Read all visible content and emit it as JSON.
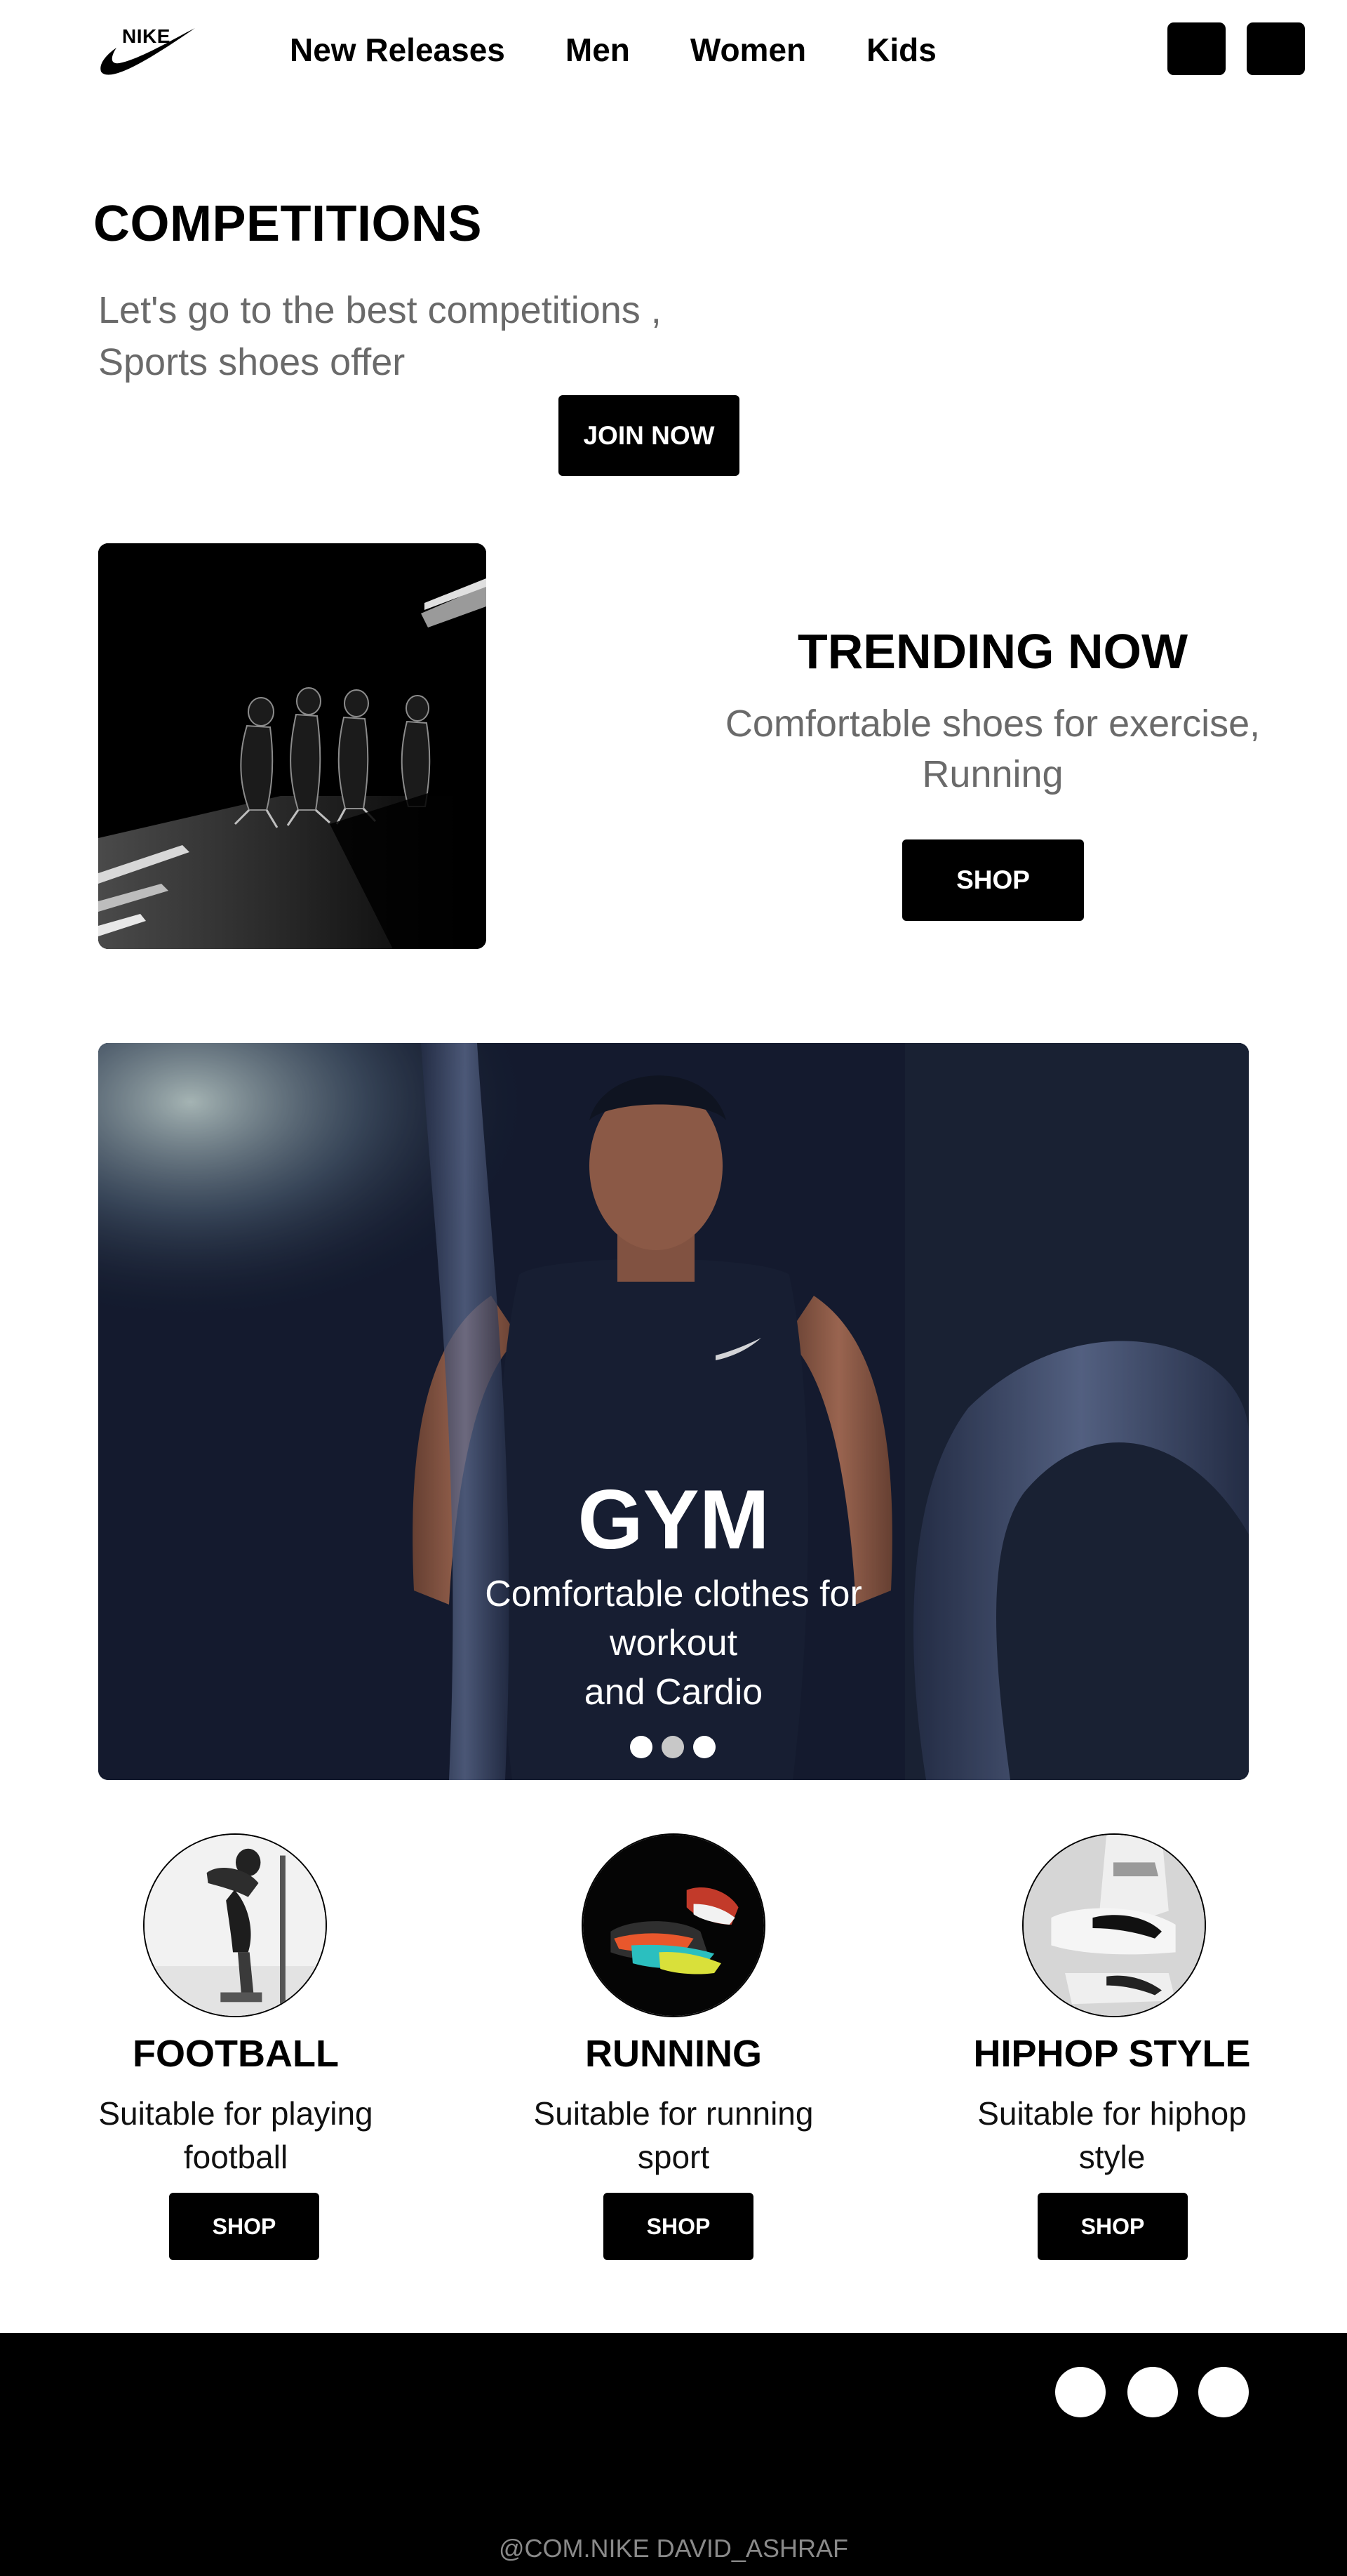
{
  "nav": {
    "logo_text": "NIKE",
    "links": [
      "New Releases",
      "Men",
      "Women",
      "Kids"
    ],
    "icons": [
      "cart-icon",
      "user-icon"
    ]
  },
  "competitions": {
    "title": "COMPETITIONS",
    "subtitle_line1": "Let's go to the best competitions ,",
    "subtitle_line2": "Sports shoes offer",
    "button": "JOIN NOW"
  },
  "trending": {
    "title": "TRENDING NOW",
    "subtitle_line1": "Comfortable shoes for exercise,",
    "subtitle_line2": "Running",
    "button": "SHOP"
  },
  "hero": {
    "title": "GYM",
    "subtitle_line1": "Comfortable clothes for workout",
    "subtitle_line2": "and Cardio",
    "slide_count": 3
  },
  "categories": [
    {
      "title": "FOOTBALL",
      "desc_line1": "Suitable for playing",
      "desc_line2": "football",
      "button": "SHOP"
    },
    {
      "title": "RUNNING",
      "desc_line1": "Suitable for running",
      "desc_line2": "sport",
      "button": "SHOP"
    },
    {
      "title": "HIPHOP STYLE",
      "desc_line1": "Suitable for hiphop",
      "desc_line2": "style",
      "button": "SHOP"
    }
  ],
  "footer": {
    "social_icons": [
      "social-icon-1",
      "social-icon-2",
      "social-icon-3"
    ],
    "copyright": "@COM.NIKE DAVID_ASHRAF"
  },
  "colors": {
    "primary": "#000000",
    "background": "#ffffff",
    "muted_text": "#6a6a6a",
    "footer_text": "#8a8a8a"
  }
}
